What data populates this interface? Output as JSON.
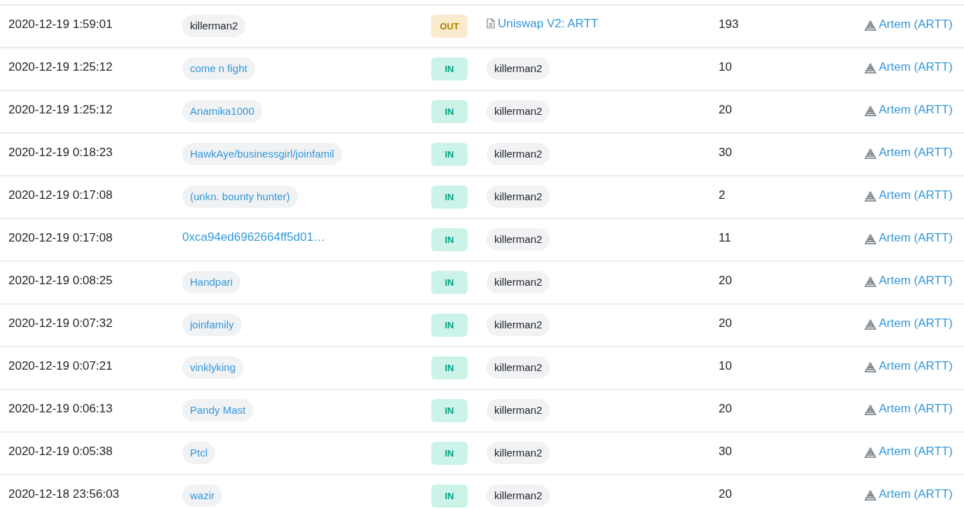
{
  "transfers": [
    {
      "time": "2020-12-19 1:59:01",
      "from": {
        "text": "killerman2",
        "kind": "tag",
        "link": false
      },
      "direction": {
        "text": "OUT",
        "kind": "out"
      },
      "to": {
        "text": "Uniswap V2: ARTT",
        "kind": "contract"
      },
      "amount": "193",
      "token": "Artem (ARTT)"
    },
    {
      "time": "2020-12-19 1:25:12",
      "from": {
        "text": "come n fight",
        "kind": "tag",
        "link": true
      },
      "direction": {
        "text": "IN",
        "kind": "in"
      },
      "to": {
        "text": "killerman2",
        "kind": "tag"
      },
      "amount": "10",
      "token": "Artem (ARTT)"
    },
    {
      "time": "2020-12-19 1:25:12",
      "from": {
        "text": "Anamika1000",
        "kind": "tag",
        "link": true
      },
      "direction": {
        "text": "IN",
        "kind": "in"
      },
      "to": {
        "text": "killerman2",
        "kind": "tag"
      },
      "amount": "20",
      "token": "Artem (ARTT)"
    },
    {
      "time": "2020-12-19 0:18:23",
      "from": {
        "text": "HawkAye/businessgirl/joinfamil",
        "kind": "tag",
        "link": true
      },
      "direction": {
        "text": "IN",
        "kind": "in"
      },
      "to": {
        "text": "killerman2",
        "kind": "tag"
      },
      "amount": "30",
      "token": "Artem (ARTT)"
    },
    {
      "time": "2020-12-19 0:17:08",
      "from": {
        "text": "(unkn. bounty hunter)",
        "kind": "tag",
        "link": true
      },
      "direction": {
        "text": "IN",
        "kind": "in"
      },
      "to": {
        "text": "killerman2",
        "kind": "tag"
      },
      "amount": "2",
      "token": "Artem (ARTT)"
    },
    {
      "time": "2020-12-19 0:17:08",
      "from": {
        "text": "0xca94ed6962664ff5d01…",
        "kind": "address",
        "link": true
      },
      "direction": {
        "text": "IN",
        "kind": "in"
      },
      "to": {
        "text": "killerman2",
        "kind": "tag"
      },
      "amount": "11",
      "token": "Artem (ARTT)"
    },
    {
      "time": "2020-12-19 0:08:25",
      "from": {
        "text": "Handpari",
        "kind": "tag",
        "link": true
      },
      "direction": {
        "text": "IN",
        "kind": "in"
      },
      "to": {
        "text": "killerman2",
        "kind": "tag"
      },
      "amount": "20",
      "token": "Artem (ARTT)"
    },
    {
      "time": "2020-12-19 0:07:32",
      "from": {
        "text": "joinfamily",
        "kind": "tag",
        "link": true
      },
      "direction": {
        "text": "IN",
        "kind": "in"
      },
      "to": {
        "text": "killerman2",
        "kind": "tag"
      },
      "amount": "20",
      "token": "Artem (ARTT)"
    },
    {
      "time": "2020-12-19 0:07:21",
      "from": {
        "text": "vinklyking",
        "kind": "tag",
        "link": true
      },
      "direction": {
        "text": "IN",
        "kind": "in"
      },
      "to": {
        "text": "killerman2",
        "kind": "tag"
      },
      "amount": "10",
      "token": "Artem (ARTT)"
    },
    {
      "time": "2020-12-19 0:06:13",
      "from": {
        "text": "Pandy Mast",
        "kind": "tag",
        "link": true
      },
      "direction": {
        "text": "IN",
        "kind": "in"
      },
      "to": {
        "text": "killerman2",
        "kind": "tag"
      },
      "amount": "20",
      "token": "Artem (ARTT)"
    },
    {
      "time": "2020-12-19 0:05:38",
      "from": {
        "text": "Ptcl",
        "kind": "tag",
        "link": true
      },
      "direction": {
        "text": "IN",
        "kind": "in"
      },
      "to": {
        "text": "killerman2",
        "kind": "tag"
      },
      "amount": "30",
      "token": "Artem (ARTT)"
    },
    {
      "time": "2020-12-18 23:56:03",
      "from": {
        "text": "wazir",
        "kind": "tag",
        "link": true
      },
      "direction": {
        "text": "IN",
        "kind": "in"
      },
      "to": {
        "text": "killerman2",
        "kind": "tag"
      },
      "amount": "20",
      "token": "Artem (ARTT)"
    }
  ]
}
